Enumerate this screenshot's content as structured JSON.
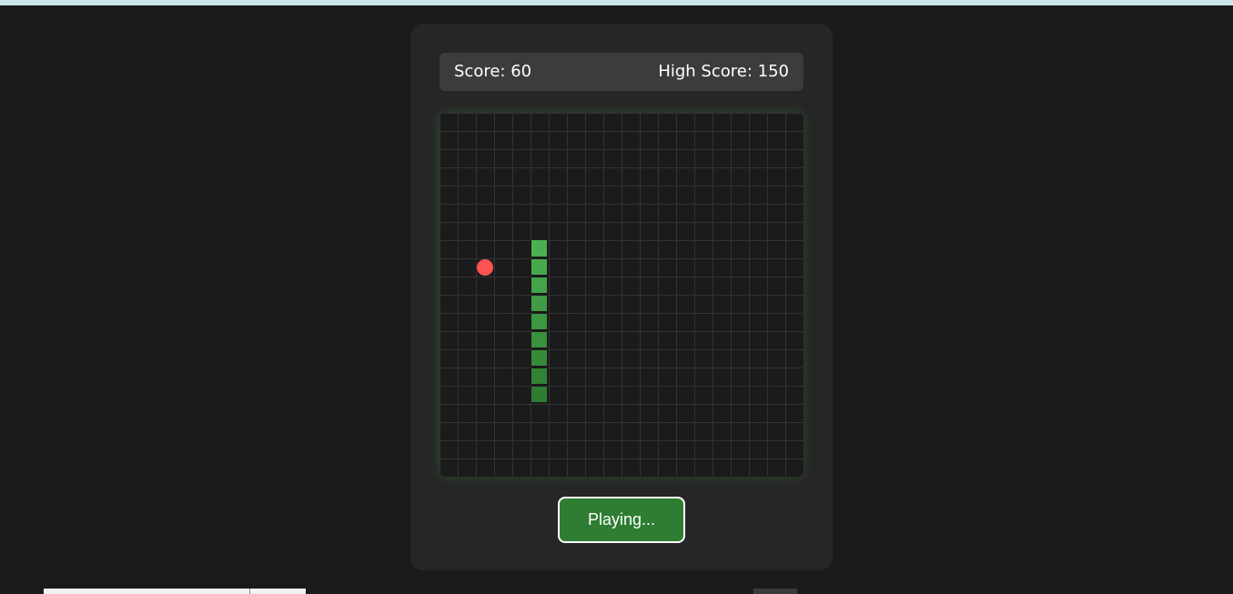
{
  "score_panel": {
    "score_text": "Score: 60",
    "high_score_text": "High Score: 150"
  },
  "board": {
    "columns": 20,
    "rows": 20,
    "snake": [
      {
        "col": 5,
        "row": 7
      },
      {
        "col": 5,
        "row": 8
      },
      {
        "col": 5,
        "row": 9
      },
      {
        "col": 5,
        "row": 10
      },
      {
        "col": 5,
        "row": 11
      },
      {
        "col": 5,
        "row": 12
      },
      {
        "col": 5,
        "row": 13
      },
      {
        "col": 5,
        "row": 14
      },
      {
        "col": 5,
        "row": 15
      }
    ],
    "food": {
      "col": 2,
      "row": 8
    },
    "colors": {
      "snake_head": "#4caf50",
      "snake_tail": "#2e7d32",
      "food": "#ff5252"
    }
  },
  "controls": {
    "status_label": "Playing..."
  }
}
